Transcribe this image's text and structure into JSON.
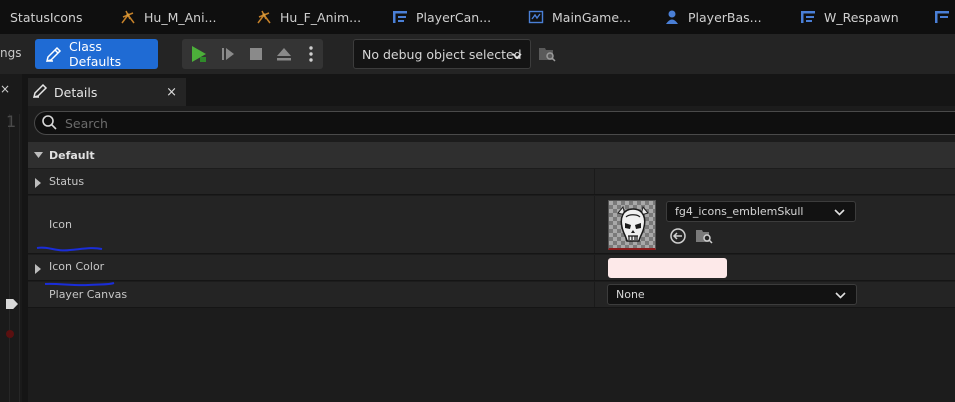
{
  "tabs": [
    {
      "label": "StatusIcons",
      "icon": "none"
    },
    {
      "label": "Hu_M_Ani...",
      "icon": "animation-icon"
    },
    {
      "label": "Hu_F_Anim...",
      "icon": "animation-icon"
    },
    {
      "label": "PlayerCan...",
      "icon": "widget-blueprint-icon"
    },
    {
      "label": "MainGame...",
      "icon": "gamemode-icon"
    },
    {
      "label": "PlayerBas...",
      "icon": "character-icon"
    },
    {
      "label": "W_Respawn",
      "icon": "widget-blueprint-icon"
    }
  ],
  "toolbar": {
    "settings_fragment": "ngs",
    "class_defaults_label": "Class Defaults",
    "debug_object_label": "No debug object selected"
  },
  "details": {
    "tab_label": "Details",
    "close_glyph": "×",
    "search_placeholder": "Search",
    "category": "Default",
    "properties": {
      "status": "Status",
      "icon": "Icon",
      "icon_value": "fg4_icons_emblemSkull",
      "icon_color": "Icon Color",
      "icon_color_value": "#fde9e9",
      "player_canvas": "Player Canvas",
      "player_canvas_value": "None"
    }
  },
  "left_panel": {
    "close_glyph": "×"
  },
  "colors": {
    "accent": "#1f6bd4",
    "play_green": "#4caf3a",
    "annotation": "#1a2dd8"
  }
}
